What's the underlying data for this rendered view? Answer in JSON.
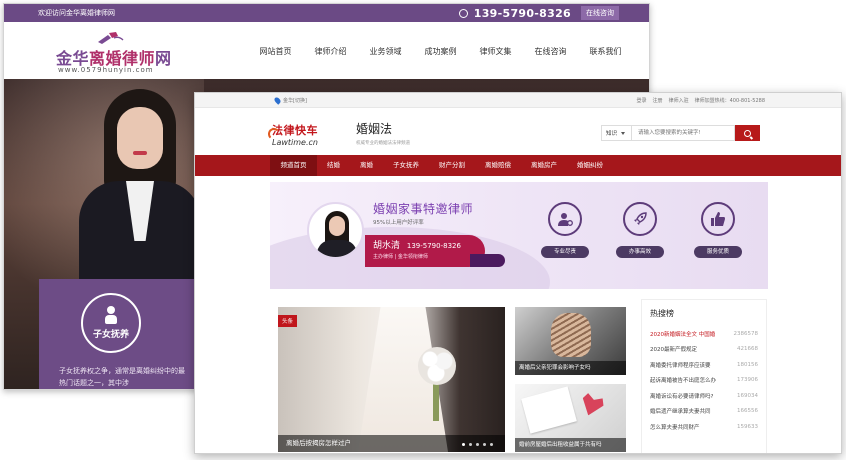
{
  "back_site": {
    "welcome": "欢迎访问金华离婚律师网",
    "phone": "139-5790-8326",
    "consult_button": "在线咨询",
    "logo": {
      "name_part1": "金华",
      "name_part2": "离婚律师",
      "name_part3": "网",
      "url": "www.0579hunyin.com"
    },
    "nav": [
      "网站首页",
      "律师介绍",
      "业务领域",
      "成功案例",
      "律师文集",
      "在线咨询",
      "联系我们"
    ],
    "feature": {
      "label": "子女抚养",
      "text": "子女抚养权之争，通常是离婚纠纷中的最热门话题之一，其中涉"
    }
  },
  "front_site": {
    "location": "金华[切换]",
    "top_links": [
      "登录",
      "注册",
      "律师入驻",
      "律师加盟热线：400-801-5288"
    ],
    "logo": {
      "cn": "法律快车",
      "en": "Lawtime.cn"
    },
    "section": {
      "title": "婚姻法",
      "subtitle": "权威专业的婚姻法法律频道"
    },
    "search": {
      "select": "知识",
      "placeholder": "请输入您要搜索的关键字!"
    },
    "nav": [
      "频道首页",
      "结婚",
      "离婚",
      "子女抚养",
      "财产分割",
      "离婚赔偿",
      "离婚房产",
      "婚姻纠纷"
    ],
    "banner": {
      "title": "婚姻家事特邀律师",
      "subtitle": "95%以上用户好评率",
      "lawyer_name": "胡水清",
      "lawyer_phone": "139-5790-8326",
      "lawyer_role": "主办律师 | 金华领衔律师",
      "features": [
        "专业尽责",
        "办事高效",
        "服务优质"
      ]
    },
    "headline": {
      "badge": "头条",
      "caption": "离婚后按揭房怎样过户",
      "dots": 5,
      "active_dot": 1
    },
    "thumbs": [
      "离婚后父亲犯罪会影响子女吗",
      "婚前房屋婚后出租收益属于共有吗"
    ],
    "hot": {
      "title": "热搜榜",
      "items": [
        {
          "title": "2020新婚姻法全文 中国婚",
          "count": "2386578"
        },
        {
          "title": "2020最新产假规定",
          "count": "421668"
        },
        {
          "title": "离婚委托律师程序应该要",
          "count": "180156"
        },
        {
          "title": "起诉离婚被告不出庭怎么办",
          "count": "173906"
        },
        {
          "title": "离婚诉讼有必要请律师吗?",
          "count": "169034"
        },
        {
          "title": "婚后遗产继承算夫妻共同",
          "count": "166556"
        },
        {
          "title": "怎么算夫妻共同财产",
          "count": "159633"
        }
      ]
    },
    "colors": {
      "brand_red": "#a5171b",
      "accent_purple": "#7b3fb0"
    }
  }
}
